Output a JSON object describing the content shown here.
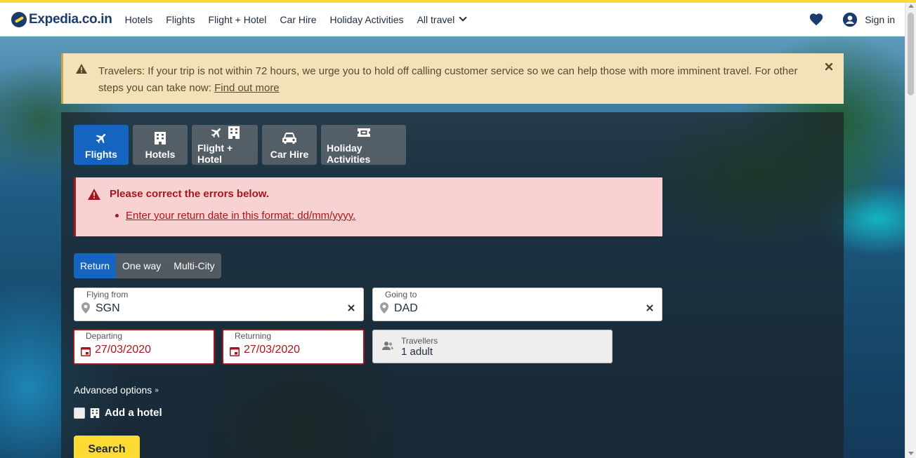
{
  "header": {
    "logo_text": "Expedia.co.in",
    "nav": [
      "Hotels",
      "Flights",
      "Flight + Hotel",
      "Car Hire",
      "Holiday Activities"
    ],
    "all_travel": "All travel",
    "sign_in": "Sign in"
  },
  "banner": {
    "text": "Travelers: If your trip is not within 72 hours, we urge you to hold off calling customer service so we can help those with more imminent travel. For other steps you can take now:",
    "link": "Find out more"
  },
  "tabs": [
    {
      "label": "Flights",
      "icon": "plane-icon",
      "active": true
    },
    {
      "label": "Hotels",
      "icon": "hotel-icon",
      "active": false
    },
    {
      "label": "Flight + Hotel",
      "icon": "plane-hotel-icon",
      "active": false
    },
    {
      "label": "Car Hire",
      "icon": "car-icon",
      "active": false
    },
    {
      "label": "Holiday Activities",
      "icon": "ticket-icon",
      "active": false
    }
  ],
  "errors": {
    "title": "Please correct the errors below.",
    "items": [
      "Enter your return date in this format: dd/mm/yyyy."
    ]
  },
  "trip_type": {
    "options": [
      "Return",
      "One way",
      "Multi-City"
    ],
    "selected": "Return"
  },
  "form": {
    "from_label": "Flying from",
    "from_value": "SGN",
    "to_label": "Going to",
    "to_value": "DAD",
    "depart_label": "Departing",
    "depart_value": "27/03/2020",
    "return_label": "Returning",
    "return_value": "27/03/2020",
    "travellers_label": "Travellers",
    "travellers_value": "1 adult"
  },
  "advanced_options": "Advanced options",
  "add_hotel": "Add a hotel",
  "search_button": "Search",
  "colors": {
    "brand_yellow": "#fddb32",
    "brand_navy": "#1b3b6f",
    "active_blue": "#1565c0",
    "error_red": "#a8161d"
  }
}
